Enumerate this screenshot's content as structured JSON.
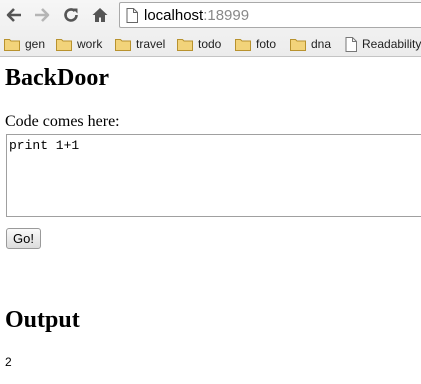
{
  "browser": {
    "url_host": "localhost",
    "url_port": ":18999",
    "icons": [
      "back-icon",
      "forward-icon",
      "reload-icon",
      "home-icon",
      "page-icon"
    ]
  },
  "bookmarks": [
    {
      "label": "gen",
      "icon": "folder-icon"
    },
    {
      "label": "work",
      "icon": "folder-icon"
    },
    {
      "label": "travel",
      "icon": "folder-icon"
    },
    {
      "label": "todo",
      "icon": "folder-icon"
    },
    {
      "label": "foto",
      "icon": "folder-icon"
    },
    {
      "label": "dna",
      "icon": "folder-icon"
    },
    {
      "label": "Readability",
      "icon": "page-icon"
    }
  ],
  "page": {
    "title": "BackDoor",
    "code_label": "Code comes here:",
    "code_value": "print 1+1",
    "submit_label": "Go!",
    "output_title": "Output",
    "output_value": "2"
  },
  "colors": {
    "folder": "#f2d37a",
    "folder_border": "#b8922e",
    "port_text": "#888888"
  }
}
